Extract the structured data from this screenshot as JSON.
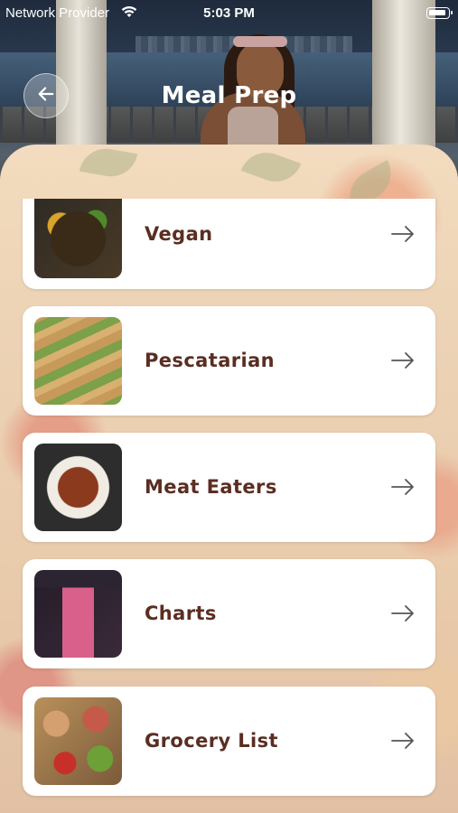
{
  "status_bar": {
    "carrier": "Network Provider",
    "time": "5:03 PM"
  },
  "header": {
    "title": "Meal Prep",
    "back_icon": "arrow-left-icon"
  },
  "menu": {
    "items": [
      {
        "label": "Vegan",
        "icon": "arrow-right-icon"
      },
      {
        "label": "Pescatarian",
        "icon": "arrow-right-icon"
      },
      {
        "label": "Meat Eaters",
        "icon": "arrow-right-icon"
      },
      {
        "label": "Charts",
        "icon": "arrow-right-icon"
      },
      {
        "label": "Grocery List",
        "icon": "arrow-right-icon"
      }
    ]
  },
  "colors": {
    "label_text": "#5a2e22",
    "card_background": "#ffffff",
    "title_text": "#ffffff"
  }
}
